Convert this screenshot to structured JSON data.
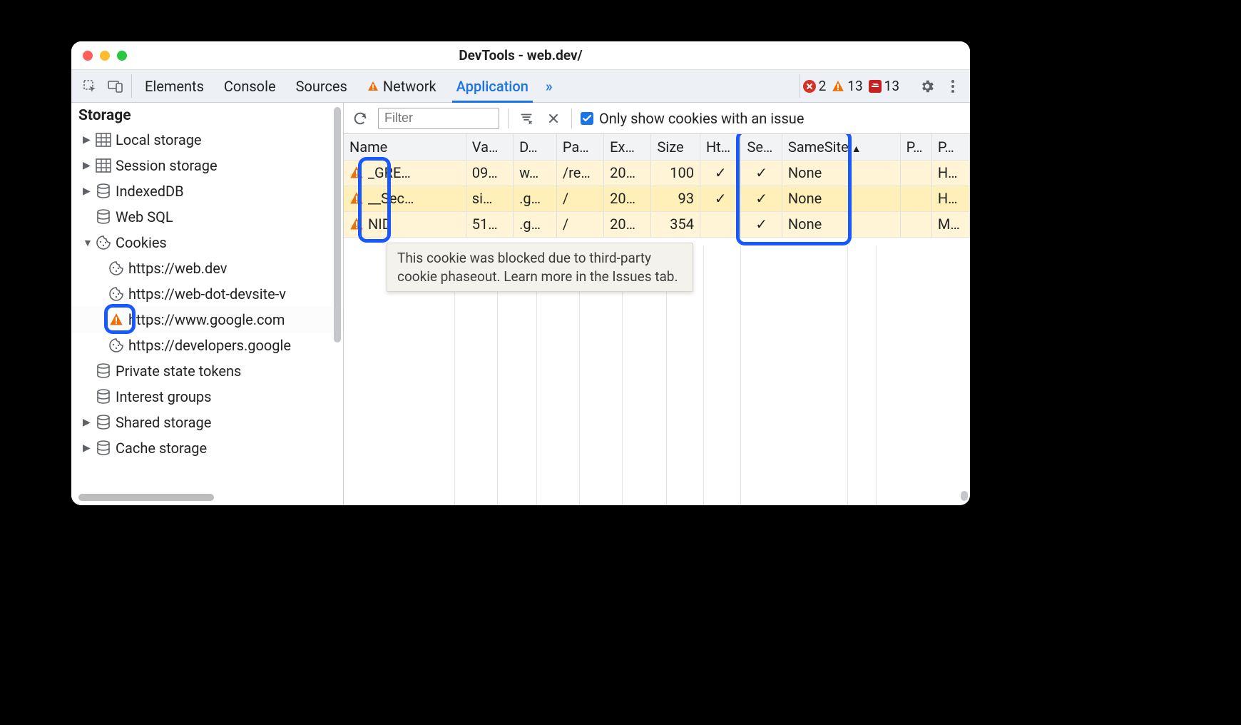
{
  "window": {
    "title": "DevTools - web.dev/"
  },
  "toolbar": {
    "tabs": [
      "Elements",
      "Console",
      "Sources",
      "Network",
      "Application"
    ],
    "active_tab": "Application",
    "network_has_warning": true,
    "more": "»",
    "errors": "2",
    "warnings": "13",
    "issues": "13"
  },
  "sidebar": {
    "section": "Storage",
    "items": [
      {
        "kind": "grid",
        "label": "Local storage",
        "expandable": true
      },
      {
        "kind": "grid",
        "label": "Session storage",
        "expandable": true
      },
      {
        "kind": "db",
        "label": "IndexedDB",
        "expandable": true
      },
      {
        "kind": "db",
        "label": "Web SQL",
        "expandable": false
      },
      {
        "kind": "cookie",
        "label": "Cookies",
        "expandable": true,
        "expanded": true,
        "children": [
          {
            "icon": "cookie",
            "label": "https://web.dev"
          },
          {
            "icon": "cookie",
            "label": "https://web-dot-devsite-v"
          },
          {
            "icon": "warn",
            "label": "https://www.google.com",
            "selected": true,
            "highlighted": true
          },
          {
            "icon": "cookie",
            "label": "https://developers.google"
          }
        ]
      },
      {
        "kind": "db",
        "label": "Private state tokens",
        "expandable": false
      },
      {
        "kind": "db",
        "label": "Interest groups",
        "expandable": false
      },
      {
        "kind": "db",
        "label": "Shared storage",
        "expandable": true
      },
      {
        "kind": "db",
        "label": "Cache storage",
        "expandable": true
      }
    ]
  },
  "filterbar": {
    "placeholder": "Filter",
    "only_issue_label": "Only show cookies with an issue",
    "only_issue_checked": true
  },
  "table": {
    "columns": [
      "Name",
      "Va…",
      "D…",
      "Pa…",
      "Ex…",
      "Size",
      "Ht…",
      "Se…",
      "SameSite",
      "P…",
      "P…"
    ],
    "sort_col": 8,
    "widths": [
      155,
      60,
      55,
      60,
      60,
      62,
      52,
      52,
      150,
      40,
      48
    ],
    "rows": [
      {
        "hl": "hl1",
        "name": "_GRE…",
        "va": "09…",
        "d": "w…",
        "pa": "/re…",
        "ex": "20…",
        "size": "100",
        "ht": "✓",
        "se": "✓",
        "ss": "None",
        "p1": "",
        "p2": "H…"
      },
      {
        "hl": "hl2",
        "name": "__Sec…",
        "va": "si…",
        "d": ".g…",
        "pa": "/",
        "ex": "20…",
        "size": "93",
        "ht": "✓",
        "se": "✓",
        "ss": "None",
        "p1": "",
        "p2": "H…"
      },
      {
        "hl": "hl1",
        "name": "NID",
        "va": "51…",
        "d": ".g…",
        "pa": "/",
        "ex": "20…",
        "size": "354",
        "ht": "",
        "se": "✓",
        "ss": "None",
        "p1": "",
        "p2": "M…"
      }
    ],
    "highlight_name_col": true,
    "highlight_samesite_col": true
  },
  "tooltip": "This cookie was blocked due to third-party cookie phaseout. Learn more in the Issues tab."
}
